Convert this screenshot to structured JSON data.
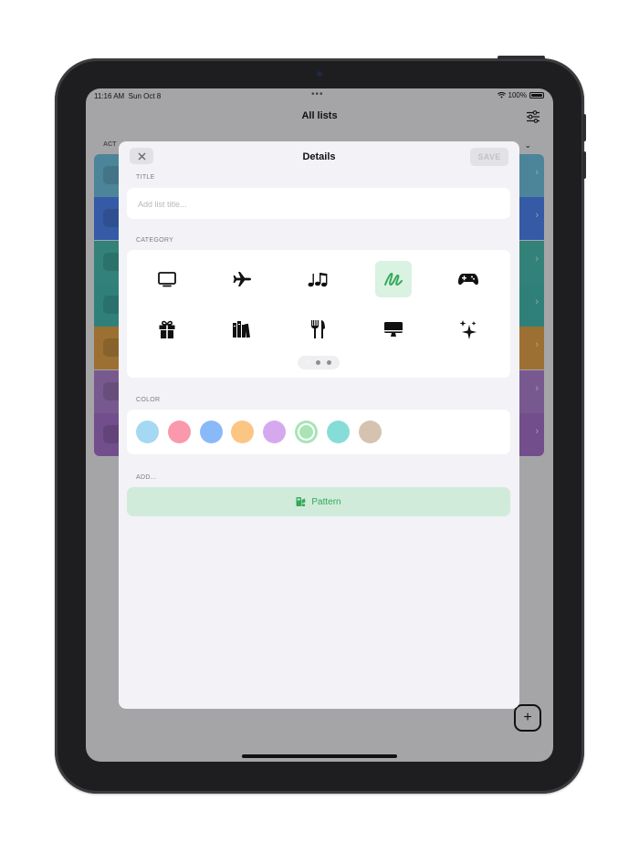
{
  "status_bar": {
    "time": "11:16 AM",
    "date": "Sun Oct 8",
    "dots": "•••",
    "battery": "100%"
  },
  "nav": {
    "title": "All lists"
  },
  "background": {
    "section_label": "ACT",
    "row_colors": [
      "#6ab8d5",
      "#4a7ee6",
      "#45b4a9",
      "#42b2a9",
      "#d89b46",
      "#a67cc6",
      "#9e6dc2"
    ]
  },
  "modal": {
    "title": "Details",
    "save_label": "SAVE",
    "title_section": "TITLE",
    "title_placeholder": "Add list title...",
    "title_value": "",
    "category_section": "CATEGORY",
    "categories": [
      {
        "icon": "tv-icon",
        "selected": false
      },
      {
        "icon": "airplane-icon",
        "selected": false
      },
      {
        "icon": "music-notes-icon",
        "selected": false
      },
      {
        "icon": "scribble-icon",
        "selected": true
      },
      {
        "icon": "gamecontroller-icon",
        "selected": false
      },
      {
        "icon": "gift-icon",
        "selected": false
      },
      {
        "icon": "books-icon",
        "selected": false
      },
      {
        "icon": "fork-knife-icon",
        "selected": false
      },
      {
        "icon": "desktop-computer-icon",
        "selected": false
      },
      {
        "icon": "sparkles-icon",
        "selected": false
      }
    ],
    "page_indicator": {
      "pages": 3,
      "current": 1
    },
    "color_section": "COLOR",
    "colors": [
      "#a5d8f3",
      "#f999ab",
      "#8ab9fa",
      "#fbc683",
      "#d6a9ef",
      "#a8e4b5",
      "#86ddd7",
      "#d5c3b0"
    ],
    "selected_color_index": 5,
    "add_section": "ADD...",
    "pattern_label": "Pattern",
    "accent": "#34a85a"
  }
}
